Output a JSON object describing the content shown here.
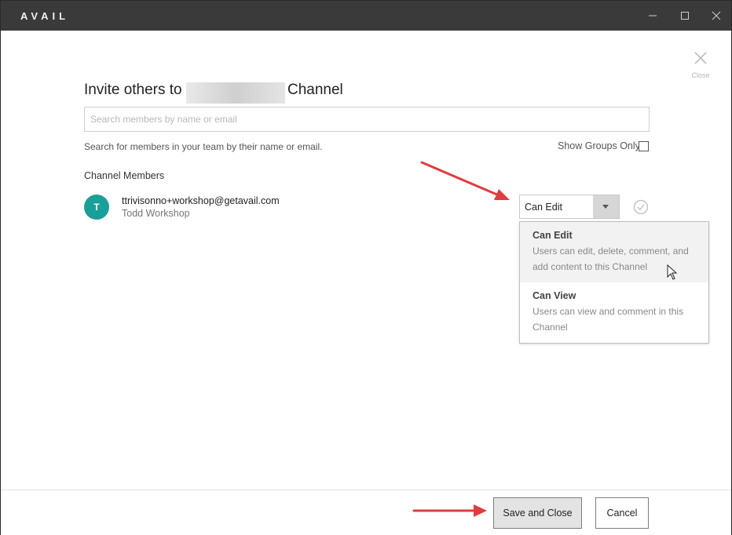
{
  "window": {
    "app_title": "AVAIL"
  },
  "dialog": {
    "close_label": "Close",
    "title_prefix": "Invite others to",
    "title_suffix": "Channel",
    "search": {
      "placeholder": "Search members by name or email",
      "value": ""
    },
    "search_hint": "Search for members in your team by their name or email.",
    "show_groups_label": "Show Groups Only",
    "show_groups_checked": false,
    "members_heading": "Channel Members",
    "members": [
      {
        "avatar_letter": "T",
        "avatar_color": "#1a9e98",
        "email": "ttrivisonno+workshop@getavail.com",
        "name": "Todd Workshop",
        "permission": "Can Edit"
      }
    ],
    "permission_options": [
      {
        "title": "Can Edit",
        "description_lines": [
          "Users can edit, delete, comment, and",
          "add content to this Channel"
        ],
        "highlighted": true
      },
      {
        "title": "Can View",
        "description_lines": [
          "Users can view and comment in this",
          "Channel"
        ],
        "highlighted": false
      }
    ]
  },
  "footer": {
    "save_label": "Save and Close",
    "cancel_label": "Cancel"
  },
  "colors": {
    "titlebar_bg": "#3a3a3a",
    "avatar_teal": "#1a9e98",
    "annotation_red": "#e03c3c"
  }
}
